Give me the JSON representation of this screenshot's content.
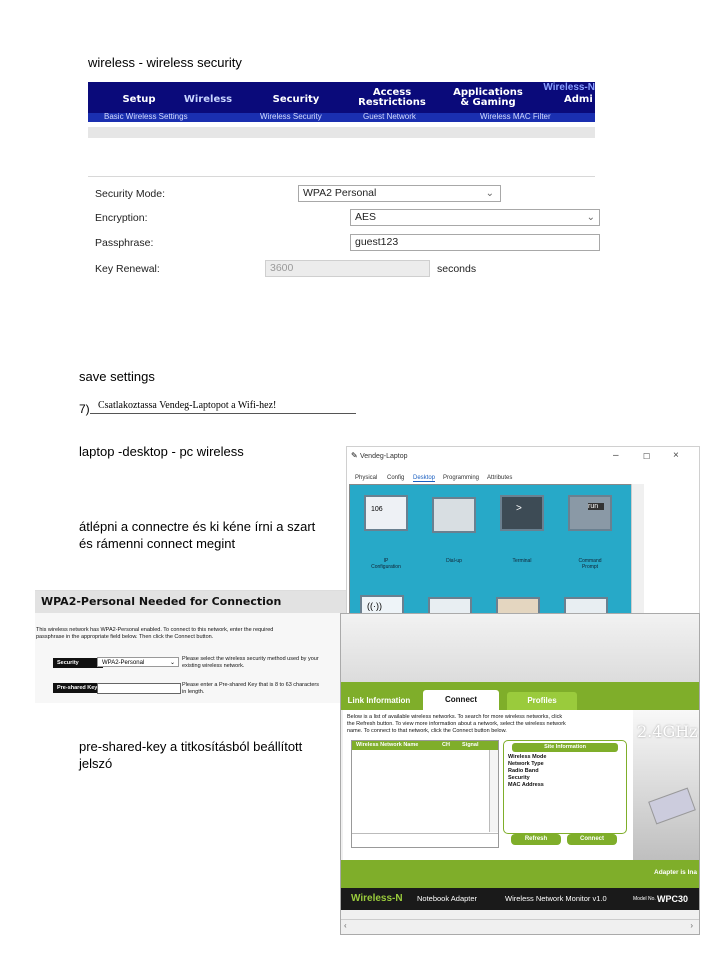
{
  "notes": {
    "line1": "wireless - wireless security",
    "save": "save settings",
    "laptop": "laptop -desktop - pc wireless",
    "atlep1": "átlépni a connectre és ki kéne írni a szart",
    "atlep2": "és rámenni connect megint",
    "psk1": "pre-shared-key a titkosításból beállított",
    "psk2": "jelszó"
  },
  "task": {
    "number": "7)",
    "text": "Csatlakoztassa Vendeg-Laptopot a Wifi-hez!"
  },
  "router": {
    "brand": "Wireless-N",
    "tabs": [
      "Setup",
      "Wireless",
      "Security",
      "Access",
      "Restrictions",
      "Applications",
      "& Gaming",
      "Admi"
    ],
    "subtabs": [
      "Basic Wireless Settings",
      "Wireless Security",
      "Guest Network",
      "Wireless MAC Filter"
    ],
    "fields": {
      "security_mode_label": "Security Mode:",
      "security_mode_value": "WPA2 Personal",
      "encryption_label": "Encryption:",
      "encryption_value": "AES",
      "passphrase_label": "Passphrase:",
      "passphrase_value": "guest123",
      "key_renewal_label": "Key Renewal:",
      "key_renewal_value": "3600",
      "key_renewal_unit": "seconds"
    }
  },
  "pt_window": {
    "title": "Vendeg-Laptop",
    "tabs": [
      "Physical",
      "Config",
      "Desktop",
      "Programming",
      "Attributes"
    ],
    "icons": [
      {
        "label1": "IP",
        "label2": "Configuration",
        "icon": "ip-config-icon"
      },
      {
        "label1": "Dial-up",
        "label2": "",
        "icon": "modem-icon"
      },
      {
        "label1": "Terminal",
        "label2": "",
        "icon": "terminal-icon"
      },
      {
        "label1": "Command",
        "label2": "Prompt",
        "icon": "command-prompt-icon"
      }
    ],
    "icon_texts": {
      "ip": "106",
      "cmd": "run",
      "term": ">",
      "wifi": "((·))"
    },
    "controls": {
      "min": "–",
      "max": "☐",
      "close": "×"
    }
  },
  "wpa_dialog": {
    "title": "WPA2-Personal Needed for Connection",
    "desc1": "This wireless network has WPA2-Personal enabled. To connect to this network, enter the required",
    "desc2": "passphrase in the appropriate field below. Then click the Connect button.",
    "security_label": "Security",
    "security_value": "WPA2-Personal",
    "security_help1": "Please select the wireless security method used by your",
    "security_help2": "existing wireless network.",
    "psk_label": "Pre-shared Key",
    "psk_help1": "Please enter a Pre-shared Key that is 8 to 63 characters",
    "psk_help2": "in length."
  },
  "monitor": {
    "tabs": [
      "Link Information",
      "Connect",
      "Profiles"
    ],
    "intro1": "Below is a list of available wireless networks. To search for more wireless networks, click",
    "intro2": "the Refresh button. To view more information about a network, select the wireless network",
    "intro3": "name. To connect to that network, click the Connect button below.",
    "columns": [
      "Wireless Network Name",
      "CH",
      "Signal"
    ],
    "site_info_title": "Site Information",
    "site_info": [
      "Wireless Mode",
      "Network Type",
      "Radio Band",
      "Security",
      "MAC Address"
    ],
    "refresh": "Refresh",
    "connect": "Connect",
    "band": "2.4GHz",
    "adapter_text": "Adapter is Ina",
    "footer_brand": "Wireless-N",
    "footer_product": "Notebook Adapter",
    "footer_app": "Wireless Network Monitor  v1.0",
    "model_label": "Model No.",
    "model": "WPC30"
  }
}
